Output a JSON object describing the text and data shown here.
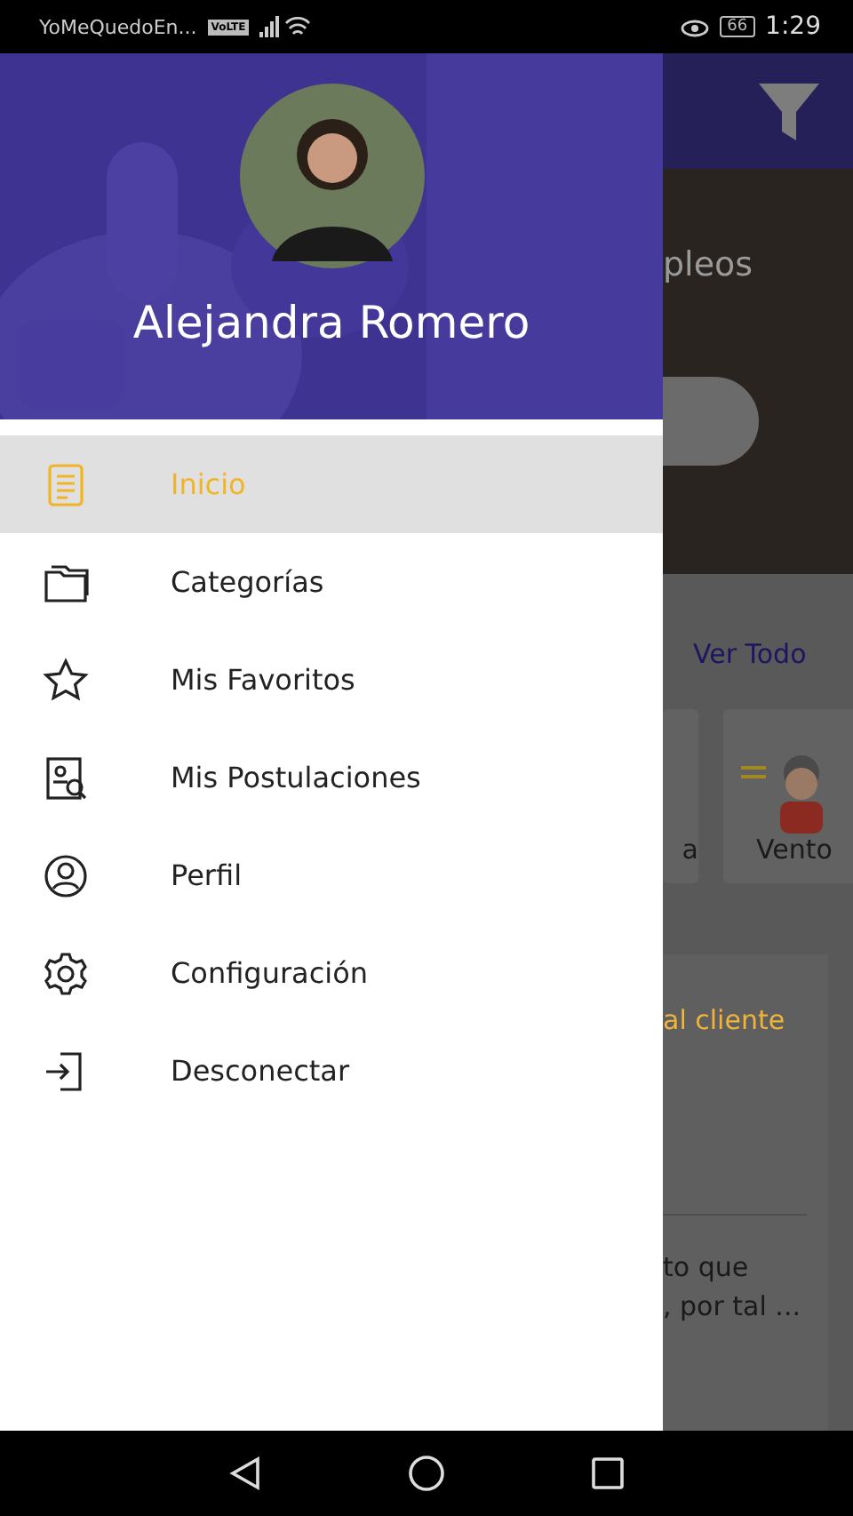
{
  "status_bar": {
    "app_name": "YoMeQuedoEn...",
    "network": "VoLTE",
    "battery": "66",
    "time": "1:29"
  },
  "drawer": {
    "user_name": "Alejandra Romero",
    "items": [
      {
        "label": "Inicio",
        "selected": true
      },
      {
        "label": "Categorías",
        "selected": false
      },
      {
        "label": "Mis Favoritos",
        "selected": false
      },
      {
        "label": "Mis Postulaciones",
        "selected": false
      },
      {
        "label": "Perfil",
        "selected": false
      },
      {
        "label": "Configuración",
        "selected": false
      },
      {
        "label": "Desconectar",
        "selected": false
      }
    ]
  },
  "background": {
    "banner_text": "pleos",
    "link": "Ver Todo",
    "categories": [
      "a",
      "Vento"
    ],
    "card_title": "al cliente",
    "card_text": [
      "to que",
      ", por tal ..."
    ]
  }
}
